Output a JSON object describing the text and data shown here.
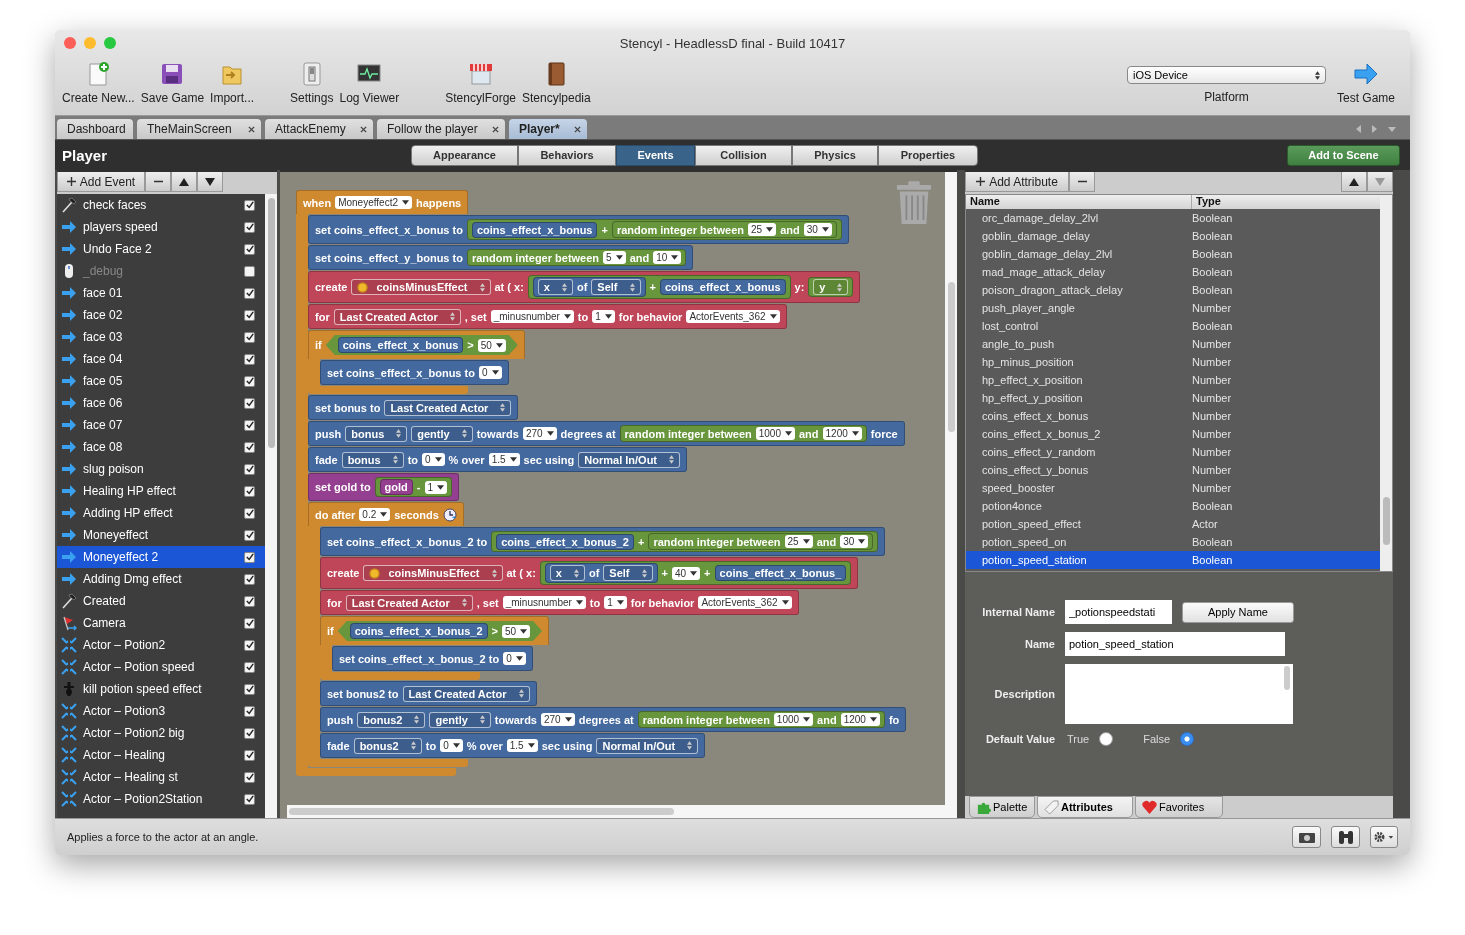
{
  "window": {
    "title": "Stencyl - HeadlessD final - Build 10417"
  },
  "toolbar": {
    "groups": [
      [
        {
          "label": "Create New...",
          "kind": "new"
        },
        {
          "label": "Save Game",
          "kind": "save"
        },
        {
          "label": "Import...",
          "kind": "import"
        }
      ],
      [
        {
          "label": "Settings",
          "kind": "settings"
        },
        {
          "label": "Log Viewer",
          "kind": "log"
        }
      ],
      [
        {
          "label": "StencylForge",
          "kind": "store"
        },
        {
          "label": "Stencylpedia",
          "kind": "book"
        }
      ]
    ],
    "platform": {
      "value": "iOS Device",
      "label": "Platform"
    },
    "test_game": "Test Game"
  },
  "document_tabs": [
    {
      "label": "Dashboard",
      "closable": false,
      "selected": false
    },
    {
      "label": "TheMainScreen",
      "closable": true,
      "selected": false
    },
    {
      "label": "AttackEnemy",
      "closable": true,
      "selected": false
    },
    {
      "label": "Follow the player",
      "closable": true,
      "selected": false
    },
    {
      "label": "Player*",
      "closable": true,
      "selected": true
    }
  ],
  "editor": {
    "title": "Player",
    "view_tabs": [
      {
        "label": "Appearance",
        "selected": false
      },
      {
        "label": "Behaviors",
        "selected": false
      },
      {
        "label": "Events",
        "selected": true
      },
      {
        "label": "Collision",
        "selected": false
      },
      {
        "label": "Physics",
        "selected": false
      },
      {
        "label": "Properties",
        "selected": false
      }
    ],
    "add_to_scene": "Add to Scene"
  },
  "events_panel": {
    "add_label": "Add Event",
    "events": [
      {
        "label": "check faces",
        "kind": "hammer",
        "checked": true,
        "disabled": false,
        "selected": false
      },
      {
        "label": "players speed",
        "kind": "arrow",
        "checked": true,
        "disabled": false,
        "selected": false
      },
      {
        "label": "Undo Face 2",
        "kind": "arrow",
        "checked": true,
        "disabled": false,
        "selected": false
      },
      {
        "label": "_debug",
        "kind": "mouse",
        "checked": false,
        "disabled": true,
        "selected": false
      },
      {
        "label": "face 01",
        "kind": "arrow",
        "checked": true,
        "disabled": false,
        "selected": false
      },
      {
        "label": "face 02",
        "kind": "arrow",
        "checked": true,
        "disabled": false,
        "selected": false
      },
      {
        "label": "face 03",
        "kind": "arrow",
        "checked": true,
        "disabled": false,
        "selected": false
      },
      {
        "label": "face 04",
        "kind": "arrow",
        "checked": true,
        "disabled": false,
        "selected": false
      },
      {
        "label": "face 05",
        "kind": "arrow",
        "checked": true,
        "disabled": false,
        "selected": false
      },
      {
        "label": "face 06",
        "kind": "arrow",
        "checked": true,
        "disabled": false,
        "selected": false
      },
      {
        "label": "face 07",
        "kind": "arrow",
        "checked": true,
        "disabled": false,
        "selected": false
      },
      {
        "label": "face 08",
        "kind": "arrow",
        "checked": true,
        "disabled": false,
        "selected": false
      },
      {
        "label": "slug poison",
        "kind": "arrow",
        "checked": true,
        "disabled": false,
        "selected": false
      },
      {
        "label": "Healing HP effect",
        "kind": "arrow",
        "checked": true,
        "disabled": false,
        "selected": false
      },
      {
        "label": "Adding HP effect",
        "kind": "arrow",
        "checked": true,
        "disabled": false,
        "selected": false
      },
      {
        "label": "Moneyeffect",
        "kind": "arrow",
        "checked": true,
        "disabled": false,
        "selected": false
      },
      {
        "label": "Moneyeffect  2",
        "kind": "arrow",
        "checked": true,
        "disabled": false,
        "selected": true
      },
      {
        "label": "Adding Dmg effect",
        "kind": "arrow",
        "checked": true,
        "disabled": false,
        "selected": false
      },
      {
        "label": "Created",
        "kind": "hammer",
        "checked": true,
        "disabled": false,
        "selected": false
      },
      {
        "label": "Camera",
        "kind": "flag",
        "checked": true,
        "disabled": false,
        "selected": false
      },
      {
        "label": "Actor – Potion2",
        "kind": "collision",
        "checked": true,
        "disabled": false,
        "selected": false
      },
      {
        "label": "Actor – Potion speed",
        "kind": "collision",
        "checked": true,
        "disabled": false,
        "selected": false
      },
      {
        "label": "kill potion speed effect",
        "kind": "dagger",
        "checked": true,
        "disabled": false,
        "selected": false
      },
      {
        "label": "Actor – Potion3",
        "kind": "collision",
        "checked": true,
        "disabled": false,
        "selected": false
      },
      {
        "label": "Actor – Potion2 big",
        "kind": "collision",
        "checked": true,
        "disabled": false,
        "selected": false
      },
      {
        "label": "Actor – Healing",
        "kind": "collision",
        "checked": true,
        "disabled": false,
        "selected": false
      },
      {
        "label": "Actor – Healing st",
        "kind": "collision",
        "checked": true,
        "disabled": false,
        "selected": false
      },
      {
        "label": "Actor – Potion2Station",
        "kind": "collision",
        "checked": true,
        "disabled": false,
        "selected": false
      }
    ]
  },
  "script": {
    "kind": "event",
    "parts": [
      {
        "kind": "label",
        "text": "when"
      },
      {
        "kind": "dropdown",
        "text": "Moneyeffect2"
      },
      {
        "kind": "label",
        "text": "happens"
      }
    ],
    "children": [
      {
        "kind": "action",
        "parts": [
          {
            "kind": "label",
            "text": "set coins_effect_x_bonus to"
          },
          {
            "kind": "math_reporter",
            "parts": [
              {
                "kind": "action_reporter",
                "parts": [
                  {
                    "kind": "label",
                    "text": "coins_effect_x_bonus"
                  }
                ]
              },
              {
                "kind": "label",
                "text": "+"
              },
              {
                "kind": "math_reporter",
                "parts": [
                  {
                    "kind": "label",
                    "text": "random integer between"
                  },
                  {
                    "kind": "dropdown",
                    "text": "25"
                  },
                  {
                    "kind": "label",
                    "text": "and"
                  },
                  {
                    "kind": "dropdown",
                    "text": "30"
                  }
                ]
              }
            ]
          }
        ]
      },
      {
        "kind": "action",
        "parts": [
          {
            "kind": "label",
            "text": "set coins_effect_y_bonus to"
          },
          {
            "kind": "math_reporter",
            "parts": [
              {
                "kind": "label",
                "text": "random integer between"
              },
              {
                "kind": "dropdown",
                "text": "5"
              },
              {
                "kind": "label",
                "text": "and"
              },
              {
                "kind": "dropdown",
                "text": "10"
              }
            ]
          }
        ]
      },
      {
        "kind": "actor",
        "parts": [
          {
            "kind": "label",
            "text": "create"
          },
          {
            "kind": "actor_chooser",
            "text": "coinsMinusEffect"
          },
          {
            "kind": "label",
            "text": "at ( x:"
          },
          {
            "kind": "math_reporter",
            "parts": [
              {
                "kind": "action_reporter",
                "parts": [
                  {
                    "kind": "chooser",
                    "text": "x"
                  },
                  {
                    "kind": "label",
                    "text": "of"
                  },
                  {
                    "kind": "chooser",
                    "text": "Self"
                  }
                ]
              },
              {
                "kind": "label",
                "text": "+"
              },
              {
                "kind": "action_reporter",
                "parts": [
                  {
                    "kind": "label",
                    "text": "coins_effect_x_bonus"
                  }
                ]
              }
            ]
          },
          {
            "kind": "label",
            "text": "y:"
          },
          {
            "kind": "math_reporter",
            "parts": [
              {
                "kind": "chooser",
                "text": "y"
              }
            ]
          }
        ]
      },
      {
        "kind": "actor",
        "parts": [
          {
            "kind": "label",
            "text": "for"
          },
          {
            "kind": "chooser",
            "text": "Last Created Actor"
          },
          {
            "kind": "label",
            "text": ", set"
          },
          {
            "kind": "dropdown",
            "text": "_minusnumber"
          },
          {
            "kind": "label",
            "text": "to"
          },
          {
            "kind": "dropdown",
            "text": "1"
          },
          {
            "kind": "label",
            "text": "for behavior"
          },
          {
            "kind": "dropdown",
            "text": "ActorEvents_362"
          }
        ]
      },
      {
        "kind": "control",
        "parts": [
          {
            "kind": "label",
            "text": "if"
          },
          {
            "kind": "condition",
            "parts": [
              {
                "kind": "action_reporter",
                "parts": [
                  {
                    "kind": "label",
                    "text": "coins_effect_x_bonus"
                  }
                ]
              },
              {
                "kind": "label",
                "text": ">"
              },
              {
                "kind": "dropdown",
                "text": "50"
              }
            ]
          }
        ],
        "children": [
          {
            "kind": "action",
            "parts": [
              {
                "kind": "label",
                "text": "set coins_effect_x_bonus to"
              },
              {
                "kind": "dropdown",
                "text": "0"
              }
            ]
          }
        ]
      },
      {
        "kind": "action",
        "parts": [
          {
            "kind": "label",
            "text": "set bonus to"
          },
          {
            "kind": "chooser",
            "text": "Last Created Actor"
          }
        ]
      },
      {
        "kind": "action",
        "parts": [
          {
            "kind": "label",
            "text": "push"
          },
          {
            "kind": "chooser",
            "text": "bonus"
          },
          {
            "kind": "chooser",
            "text": "gently"
          },
          {
            "kind": "label",
            "text": "towards"
          },
          {
            "kind": "dropdown",
            "text": "270"
          },
          {
            "kind": "label",
            "text": "degrees at"
          },
          {
            "kind": "math_reporter",
            "parts": [
              {
                "kind": "label",
                "text": "random integer between"
              },
              {
                "kind": "dropdown",
                "text": "1000"
              },
              {
                "kind": "label",
                "text": "and"
              },
              {
                "kind": "dropdown",
                "text": "1200"
              }
            ]
          },
          {
            "kind": "label",
            "text": "force"
          }
        ]
      },
      {
        "kind": "action",
        "parts": [
          {
            "kind": "label",
            "text": "fade"
          },
          {
            "kind": "chooser",
            "text": "bonus"
          },
          {
            "kind": "label",
            "text": "to"
          },
          {
            "kind": "dropdown",
            "text": "0"
          },
          {
            "kind": "label",
            "text": "% over"
          },
          {
            "kind": "dropdown",
            "text": "1.5"
          },
          {
            "kind": "label",
            "text": "sec using"
          },
          {
            "kind": "chooser",
            "text": "Normal In/Out"
          }
        ]
      },
      {
        "kind": "attribute",
        "parts": [
          {
            "kind": "label",
            "text": "set gold to"
          },
          {
            "kind": "math_reporter",
            "parts": [
              {
                "kind": "attribute_reporter",
                "parts": [
                  {
                    "kind": "label",
                    "text": "gold"
                  }
                ]
              },
              {
                "kind": "label",
                "text": "-"
              },
              {
                "kind": "dropdown",
                "text": "1"
              }
            ]
          }
        ]
      },
      {
        "kind": "control",
        "parts": [
          {
            "kind": "label",
            "text": "do after"
          },
          {
            "kind": "dropdown",
            "text": "0.2"
          },
          {
            "kind": "label",
            "text": "seconds"
          },
          {
            "kind": "timer_icon"
          }
        ],
        "children": [
          {
            "kind": "action",
            "parts": [
              {
                "kind": "label",
                "text": "set coins_effect_x_bonus_2 to"
              },
              {
                "kind": "math_reporter",
                "parts": [
                  {
                    "kind": "action_reporter",
                    "parts": [
                      {
                        "kind": "label",
                        "text": "coins_effect_x_bonus_2"
                      }
                    ]
                  },
                  {
                    "kind": "label",
                    "text": "+"
                  },
                  {
                    "kind": "math_reporter",
                    "parts": [
                      {
                        "kind": "label",
                        "text": "random integer between"
                      },
                      {
                        "kind": "dropdown",
                        "text": "25"
                      },
                      {
                        "kind": "label",
                        "text": "and"
                      },
                      {
                        "kind": "dropdown",
                        "text": "30"
                      }
                    ]
                  }
                ]
              }
            ]
          },
          {
            "kind": "actor",
            "parts": [
              {
                "kind": "label",
                "text": "create"
              },
              {
                "kind": "actor_chooser",
                "text": "coinsMinusEffect"
              },
              {
                "kind": "label",
                "text": "at ( x:"
              },
              {
                "kind": "math_reporter",
                "parts": [
                  {
                    "kind": "action_reporter",
                    "parts": [
                      {
                        "kind": "chooser",
                        "text": "x"
                      },
                      {
                        "kind": "label",
                        "text": "of"
                      },
                      {
                        "kind": "chooser",
                        "text": "Self"
                      }
                    ]
                  },
                  {
                    "kind": "label",
                    "text": "+"
                  },
                  {
                    "kind": "dropdown",
                    "text": "40"
                  },
                  {
                    "kind": "label",
                    "text": "+"
                  },
                  {
                    "kind": "action_reporter",
                    "parts": [
                      {
                        "kind": "label",
                        "text": "coins_effect_x_bonus_"
                      }
                    ]
                  }
                ]
              }
            ]
          },
          {
            "kind": "actor",
            "parts": [
              {
                "kind": "label",
                "text": "for"
              },
              {
                "kind": "chooser",
                "text": "Last Created Actor"
              },
              {
                "kind": "label",
                "text": ", set"
              },
              {
                "kind": "dropdown",
                "text": "_minusnumber"
              },
              {
                "kind": "label",
                "text": "to"
              },
              {
                "kind": "dropdown",
                "text": "1"
              },
              {
                "kind": "label",
                "text": "for behavior"
              },
              {
                "kind": "dropdown",
                "text": "ActorEvents_362"
              }
            ]
          },
          {
            "kind": "control",
            "parts": [
              {
                "kind": "label",
                "text": "if"
              },
              {
                "kind": "condition",
                "parts": [
                  {
                    "kind": "action_reporter",
                    "parts": [
                      {
                        "kind": "label",
                        "text": "coins_effect_x_bonus_2"
                      }
                    ]
                  },
                  {
                    "kind": "label",
                    "text": ">"
                  },
                  {
                    "kind": "dropdown",
                    "text": "50"
                  }
                ]
              }
            ],
            "children": [
              {
                "kind": "action",
                "parts": [
                  {
                    "kind": "label",
                    "text": "set coins_effect_x_bonus_2 to"
                  },
                  {
                    "kind": "dropdown",
                    "text": "0"
                  }
                ]
              }
            ]
          },
          {
            "kind": "action",
            "parts": [
              {
                "kind": "label",
                "text": "set bonus2 to"
              },
              {
                "kind": "chooser",
                "text": "Last Created Actor"
              }
            ]
          },
          {
            "kind": "action",
            "parts": [
              {
                "kind": "label",
                "text": "push"
              },
              {
                "kind": "chooser",
                "text": "bonus2"
              },
              {
                "kind": "chooser",
                "text": "gently"
              },
              {
                "kind": "label",
                "text": "towards"
              },
              {
                "kind": "dropdown",
                "text": "270"
              },
              {
                "kind": "label",
                "text": "degrees at"
              },
              {
                "kind": "math_reporter",
                "parts": [
                  {
                    "kind": "label",
                    "text": "random integer between"
                  },
                  {
                    "kind": "dropdown",
                    "text": "1000"
                  },
                  {
                    "kind": "label",
                    "text": "and"
                  },
                  {
                    "kind": "dropdown",
                    "text": "1200"
                  }
                ]
              },
              {
                "kind": "label",
                "text": "fo"
              }
            ]
          },
          {
            "kind": "action",
            "parts": [
              {
                "kind": "label",
                "text": "fade"
              },
              {
                "kind": "chooser",
                "text": "bonus2"
              },
              {
                "kind": "label",
                "text": "to"
              },
              {
                "kind": "dropdown",
                "text": "0"
              },
              {
                "kind": "label",
                "text": "% over"
              },
              {
                "kind": "dropdown",
                "text": "1.5"
              },
              {
                "kind": "label",
                "text": "sec using"
              },
              {
                "kind": "chooser",
                "text": "Normal In/Out"
              }
            ]
          }
        ]
      }
    ]
  },
  "attributes_panel": {
    "add_label": "Add Attribute",
    "columns": [
      "Name",
      "Type"
    ],
    "rows": [
      {
        "name": "orc_damage_delay_2lvl",
        "type": "Boolean",
        "selected": false
      },
      {
        "name": "goblin_damage_delay",
        "type": "Boolean",
        "selected": false
      },
      {
        "name": "goblin_damage_delay_2lvl",
        "type": "Boolean",
        "selected": false
      },
      {
        "name": "mad_mage_attack_delay",
        "type": "Boolean",
        "selected": false
      },
      {
        "name": "poison_dragon_attack_delay",
        "type": "Boolean",
        "selected": false
      },
      {
        "name": "push_player_angle",
        "type": "Number",
        "selected": false
      },
      {
        "name": "lost_control",
        "type": "Boolean",
        "selected": false
      },
      {
        "name": "angle_to_push",
        "type": "Number",
        "selected": false
      },
      {
        "name": "hp_minus_position",
        "type": "Number",
        "selected": false
      },
      {
        "name": "hp_effect_x_position",
        "type": "Number",
        "selected": false
      },
      {
        "name": "hp_effect_y_position",
        "type": "Number",
        "selected": false
      },
      {
        "name": "coins_effect_x_bonus",
        "type": "Number",
        "selected": false
      },
      {
        "name": "coins_effect_x_bonus_2",
        "type": "Number",
        "selected": false
      },
      {
        "name": "coins_effect_y_random",
        "type": "Number",
        "selected": false
      },
      {
        "name": "coins_effect_y_bonus",
        "type": "Number",
        "selected": false
      },
      {
        "name": "speed_booster",
        "type": "Number",
        "selected": false
      },
      {
        "name": "potion4once",
        "type": "Boolean",
        "selected": false
      },
      {
        "name": "potion_speed_effect",
        "type": "Actor",
        "selected": false
      },
      {
        "name": "potion_speed_on",
        "type": "Boolean",
        "selected": false
      },
      {
        "name": "potion_speed_station",
        "type": "Boolean",
        "selected": true
      }
    ],
    "form": {
      "internal_name": {
        "label": "Internal Name",
        "value": "_potionspeedstati"
      },
      "apply_button": "Apply Name",
      "name": {
        "label": "Name",
        "value": "potion_speed_station"
      },
      "description": {
        "label": "Description"
      },
      "default_value": {
        "label": "Default Value",
        "options": [
          {
            "label": "True",
            "selected": false
          },
          {
            "label": "False",
            "selected": true
          }
        ]
      }
    },
    "bottom_tabs": [
      {
        "label": "Palette",
        "kind": "puzzle",
        "selected": false
      },
      {
        "label": "Attributes",
        "kind": "tag",
        "selected": true
      },
      {
        "label": "Favorites",
        "kind": "heart",
        "selected": false
      }
    ]
  },
  "status_bar": {
    "text": "Applies a force to the actor at an angle."
  }
}
